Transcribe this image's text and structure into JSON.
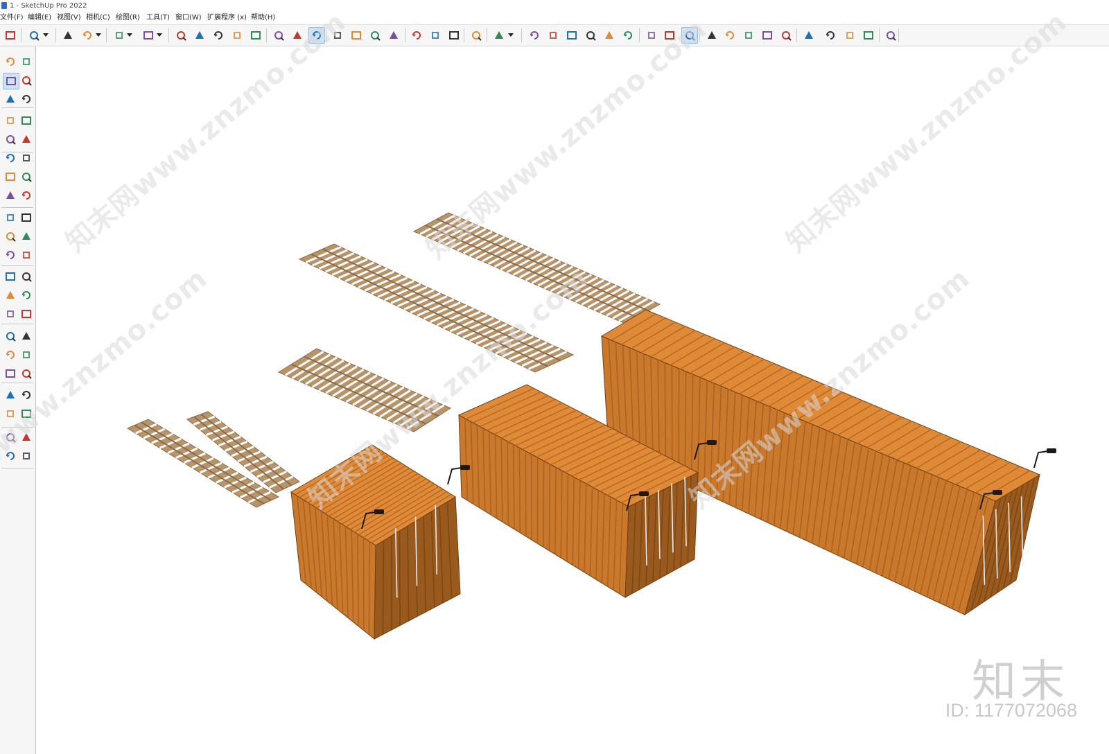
{
  "window": {
    "title": "1 - SketchUp Pro 2022"
  },
  "menu": [
    {
      "label": "文件(F)"
    },
    {
      "label": "编辑(E)"
    },
    {
      "label": "视图(V)"
    },
    {
      "label": "相机(C)"
    },
    {
      "label": "绘图(R)"
    },
    {
      "label": "工具(T)"
    },
    {
      "label": "窗口(W)"
    },
    {
      "label": "扩展程序 (x)"
    },
    {
      "label": "帮助(H)"
    }
  ],
  "toolbar": {
    "icons": [
      "zoom-icon",
      "select-icon",
      "eraser-icon",
      "pencil-icon",
      "arc-icon",
      "shape-icon",
      "push-pull-icon",
      "follow-me-icon",
      "move-icon",
      "rotate-icon",
      "scale-icon",
      "tape-measure-icon",
      "text-icon",
      "paint-bucket-icon",
      "orbit-icon",
      "pan-icon",
      "zoom-window-icon",
      "zoom-extents-icon",
      "sandbox-icon",
      "layers-icon",
      "outliner-icon",
      "solid-tools-icon",
      "user-icon",
      "iso-view-icon",
      "front-view-icon",
      "top-view-icon",
      "right-view-icon",
      "back-view-icon",
      "left-view-icon",
      "components-icon",
      "section-plane-icon",
      "display-section-icon",
      "add-location-icon",
      "terrain-icon",
      "model-info-icon",
      "styles-icon",
      "cloud-icon",
      "extension-manager-icon",
      "scenes-icon",
      "info-icon",
      "warehouse-icon",
      "account-icon"
    ]
  },
  "watermark": {
    "text": "知末网www.znzmo.com",
    "brand": "知末",
    "id": "ID: 1177072068"
  },
  "colors": {
    "container": "#c9782c",
    "container_dark": "#9a5a1e",
    "container_light": "#e08a38",
    "pallet": "#b8946a",
    "pallet_dark": "#8a6a48",
    "toolbar_bg": "#f6f6f6",
    "active_tool": "#cfe3f7"
  }
}
